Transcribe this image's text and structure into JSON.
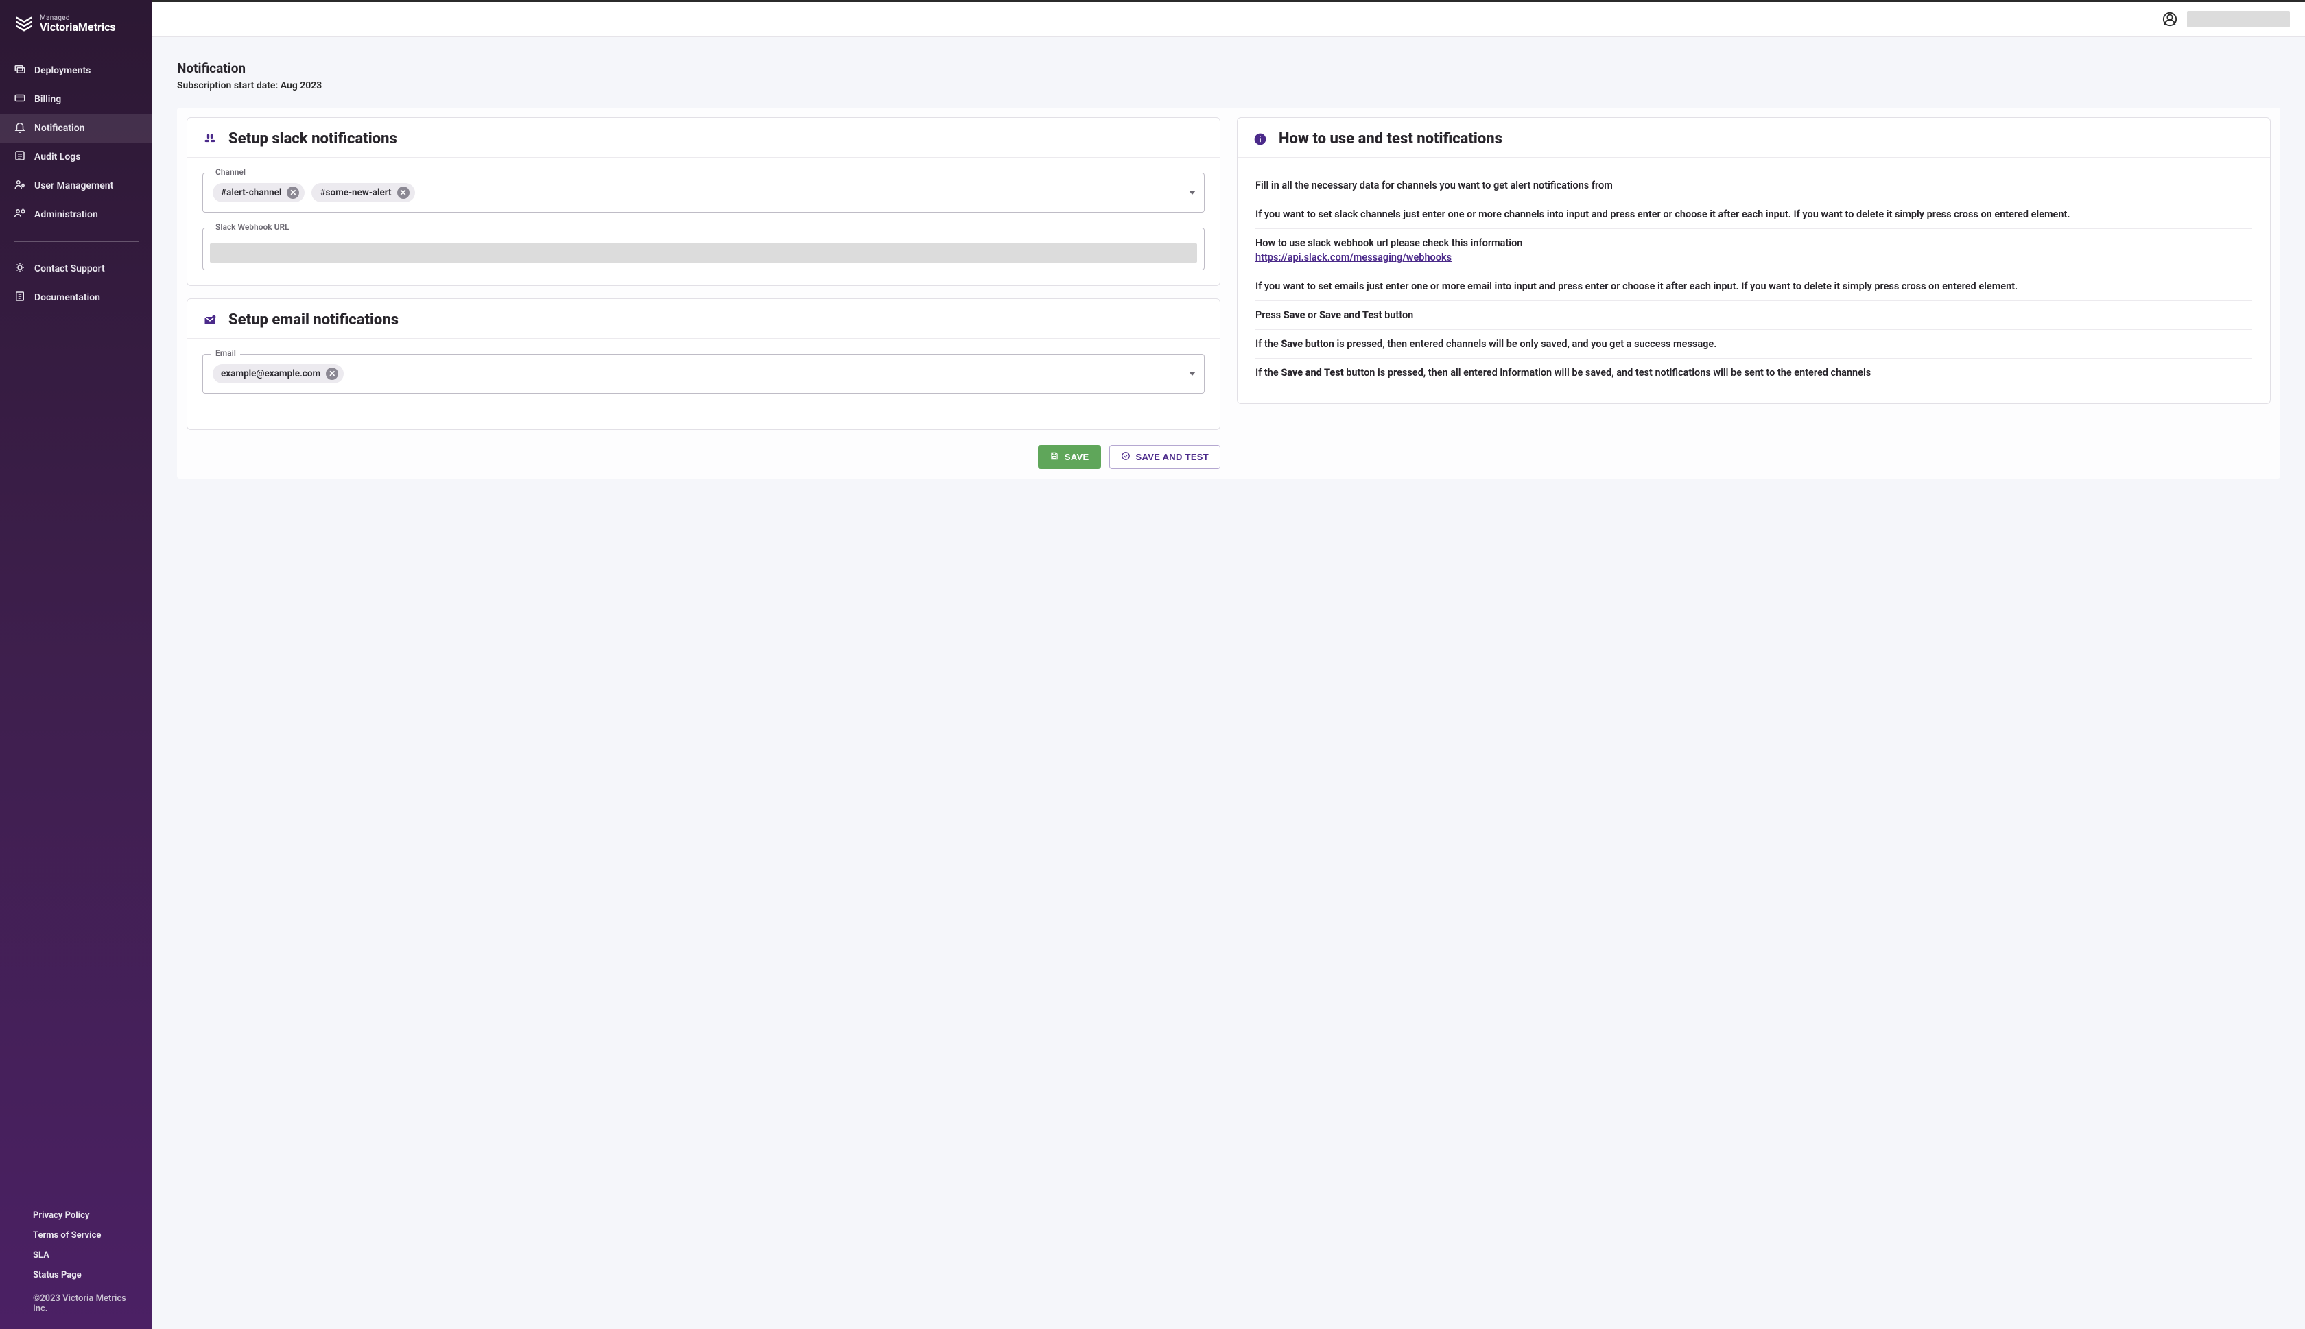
{
  "brand": {
    "small": "Managed",
    "strong": "VictoriaMetrics"
  },
  "sidebar": {
    "items": [
      {
        "label": "Deployments"
      },
      {
        "label": "Billing"
      },
      {
        "label": "Notification"
      },
      {
        "label": "Audit Logs"
      },
      {
        "label": "User Management"
      },
      {
        "label": "Administration"
      }
    ],
    "support": [
      {
        "label": "Contact Support"
      },
      {
        "label": "Documentation"
      }
    ],
    "legal": [
      {
        "label": "Privacy Policy"
      },
      {
        "label": "Terms of Service"
      },
      {
        "label": "SLA"
      },
      {
        "label": "Status Page"
      }
    ],
    "copyright": "©2023 Victoria Metrics Inc."
  },
  "page": {
    "title": "Notification",
    "subtitle": "Subscription start date: Aug 2023"
  },
  "slack_card": {
    "title": "Setup slack notifications",
    "channel_field_label": "Channel",
    "channels": [
      "#alert-channel",
      "#some-new-alert"
    ],
    "webhook_field_label": "Slack Webhook URL"
  },
  "email_card": {
    "title": "Setup email notifications",
    "email_field_label": "Email",
    "emails": [
      "example@example.com"
    ]
  },
  "info_card": {
    "title": "How to use and test notifications",
    "p1": "Fill in all the necessary data for channels you want to get alert notifications from",
    "p2": "If you want to set slack channels just enter one or more channels into input and press enter or choose it after each input. If you want to delete it simply press cross on entered element.",
    "p3a": "How to use slack webhook url please check this information",
    "p3_link": "https://api.slack.com/messaging/webhooks",
    "p4": "If you want to set emails just enter one or more email into input and press enter or choose it after each input. If you want to delete it simply press cross on entered element.",
    "p5a": "Press ",
    "p5b": "Save",
    "p5c": " or ",
    "p5d": "Save and Test",
    "p5e": " button",
    "p6a": "If the ",
    "p6b": "Save",
    "p6c": " button is pressed, then entered channels will be only saved, and you get a success message.",
    "p7a": "If the ",
    "p7b": "Save and Test",
    "p7c": " button is pressed, then all entered information will be saved, and test notifications will be sent to the entered channels"
  },
  "buttons": {
    "save": "SAVE",
    "save_and_test": "SAVE AND TEST"
  }
}
